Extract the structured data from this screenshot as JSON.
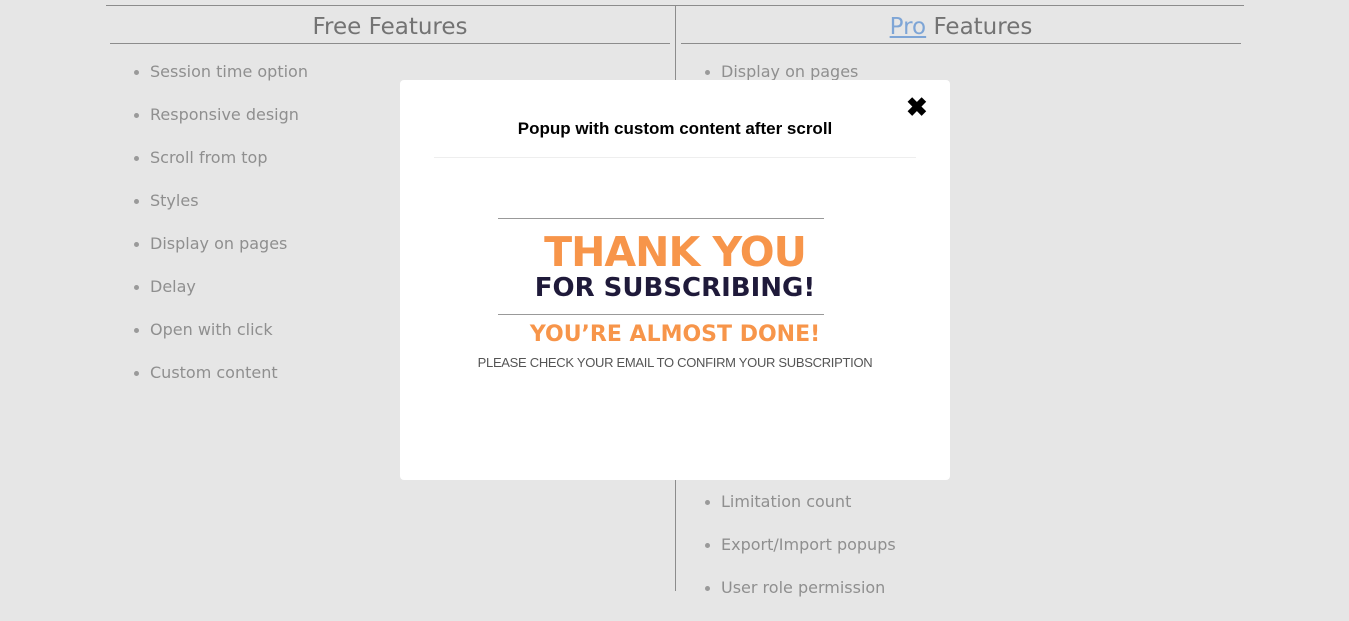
{
  "free": {
    "title": "Free Features",
    "items": [
      "Session time option",
      "Responsive design",
      "Scroll from top",
      "Styles",
      "Display on pages",
      "Delay",
      "Open with click",
      "Custom content"
    ]
  },
  "pro": {
    "title_link": "Pro",
    "title_rest": " Features",
    "items_top": [
      "Display on pages"
    ],
    "items_bottom": [
      "Limitation count",
      "Export/Import popups",
      "User role permission"
    ]
  },
  "popup": {
    "title": "Popup with custom content after scroll",
    "close_icon": "close-icon",
    "image": {
      "line1": "THANK YOU",
      "line2": "FOR SUBSCRIBING!",
      "line3": "YOU’RE ALMOST DONE!",
      "line4": "PLEASE CHECK YOUR EMAIL TO CONFIRM YOUR SUBSCRIPTION"
    }
  },
  "colors": {
    "accent_orange": "#f7954a",
    "navy": "#1f1a3a",
    "link": "#7ea5d6"
  }
}
